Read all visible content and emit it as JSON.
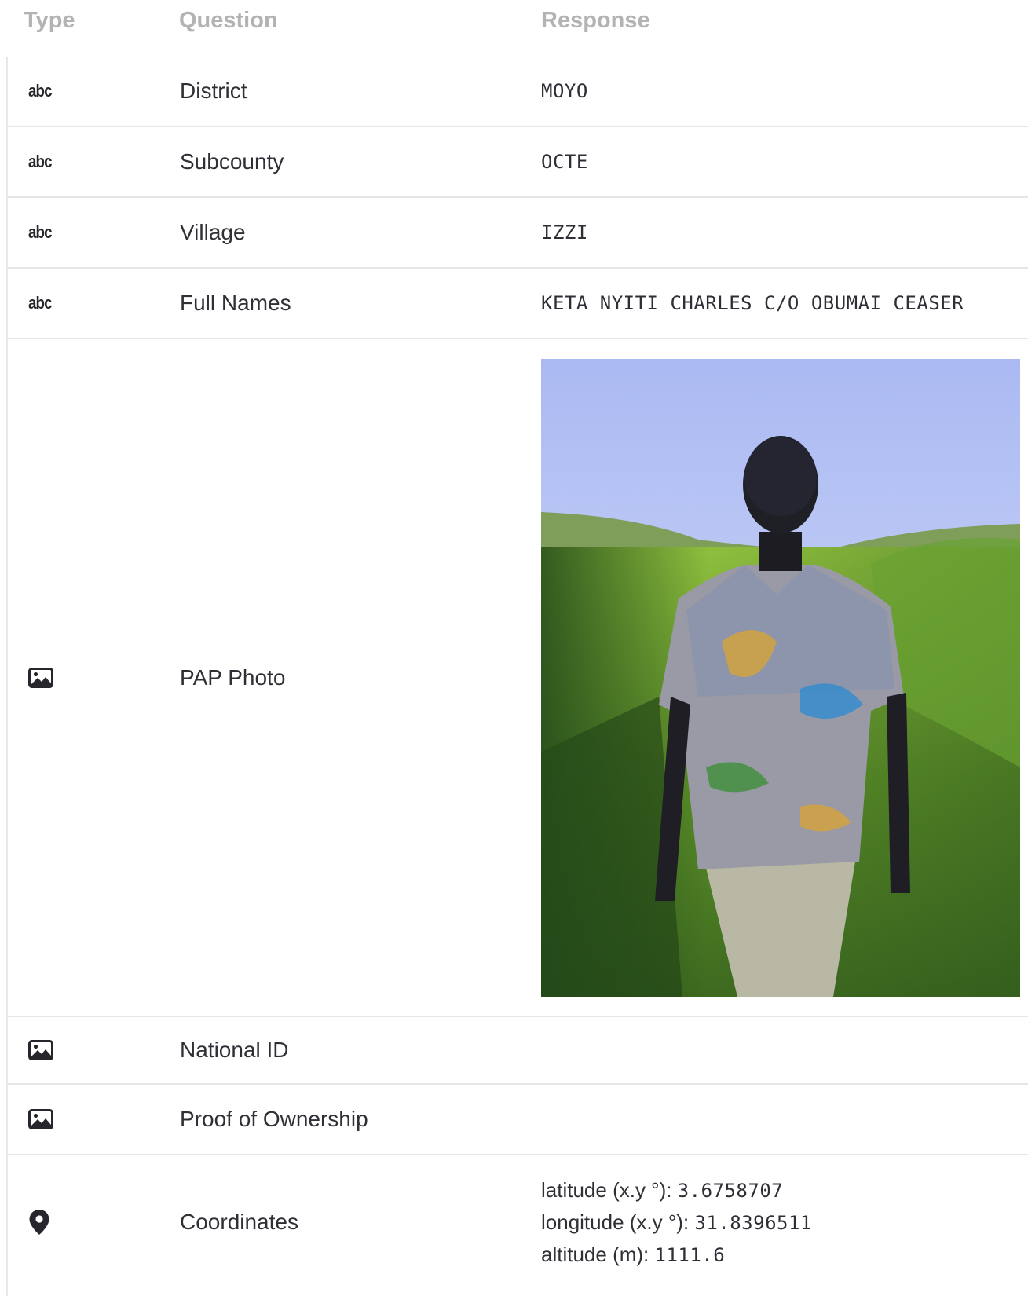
{
  "header": {
    "type": "Type",
    "question": "Question",
    "response": "Response"
  },
  "rows": [
    {
      "type_label": "abc",
      "question": "District",
      "response": "MOYO"
    },
    {
      "type_label": "abc",
      "question": "Subcounty",
      "response": "OCTE"
    },
    {
      "type_label": "abc",
      "question": "Village",
      "response": "IZZI"
    },
    {
      "type_label": "abc",
      "question": "Full Names",
      "response": "KETA NYITI CHARLES C/O OBUMAI CEASER"
    },
    {
      "type_icon": "image-icon",
      "question": "PAP Photo",
      "response_image": "photo-of-person-in-grassland"
    },
    {
      "type_icon": "image-icon",
      "question": "National ID",
      "response": ""
    },
    {
      "type_icon": "image-icon",
      "question": "Proof of Ownership",
      "response": ""
    },
    {
      "type_icon": "location-pin-icon",
      "question": "Coordinates",
      "coordinates": {
        "latitude_label": "latitude (x.y °): ",
        "latitude": "3.6758707",
        "longitude_label": "longitude (x.y °): ",
        "longitude": "31.8396511",
        "altitude_label": "altitude (m): ",
        "altitude": "1111.6"
      }
    }
  ]
}
